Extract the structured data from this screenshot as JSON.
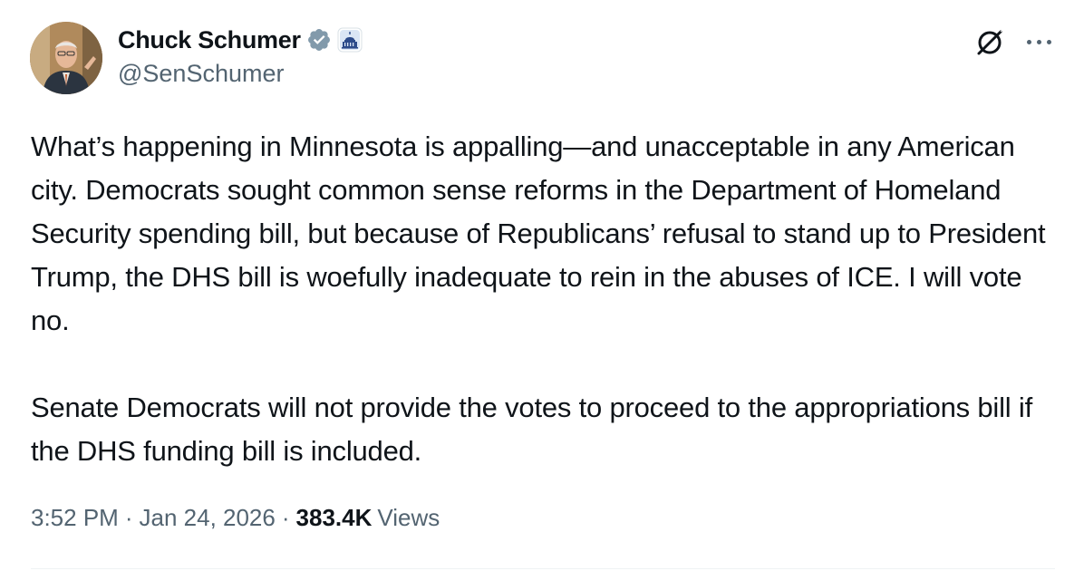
{
  "author": {
    "name": "Chuck Schumer",
    "handle": "@SenSchumer",
    "verified": true,
    "badge_color": "#829aab"
  },
  "icons": {
    "grok": "grok-icon",
    "more": "more-options-icon",
    "verified": "verified-badge-icon",
    "affiliation": "us-capitol-badge-icon"
  },
  "tweet": {
    "paragraphs": [
      "What’s happening in Minnesota is appalling—and unacceptable in any American city. Democrats sought common sense reforms in the Department of Homeland Security spending bill, but because of Republicans’ refusal to stand up to President Trump, the DHS bill is woefully inadequate to rein in the abuses of ICE. I will vote no.",
      "Senate Democrats will not provide the votes to proceed to the appropriations bill if the DHS funding bill is included."
    ]
  },
  "meta": {
    "time": "3:52 PM",
    "separator": "·",
    "date": "Jan 24, 2026",
    "views_count": "383.4K",
    "views_label": "Views"
  }
}
